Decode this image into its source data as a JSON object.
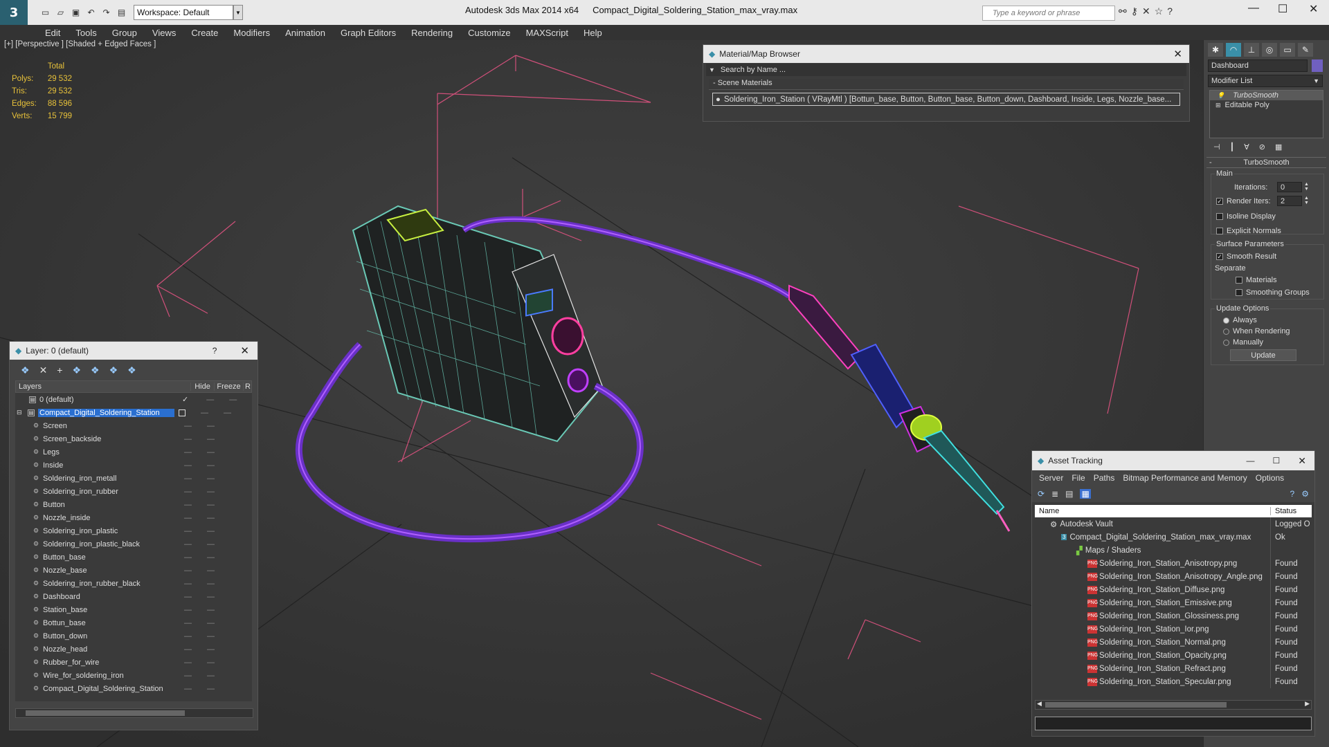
{
  "app": {
    "workspace": "Workspace: Default",
    "title_app": "Autodesk 3ds Max  2014 x64",
    "title_file": "Compact_Digital_Soldering_Station_max_vray.max",
    "search_placeholder": "Type a keyword or phrase"
  },
  "menu": [
    "Edit",
    "Tools",
    "Group",
    "Views",
    "Create",
    "Modifiers",
    "Animation",
    "Graph Editors",
    "Rendering",
    "Customize",
    "MAXScript",
    "Help"
  ],
  "viewport": {
    "label": "[+] [Perspective ] [Shaded + Edged Faces ]",
    "stats_header": "Total",
    "stats": [
      {
        "label": "Polys:",
        "value": "29 532"
      },
      {
        "label": "Tris:",
        "value": "29 532"
      },
      {
        "label": "Edges:",
        "value": "88 596"
      },
      {
        "label": "Verts:",
        "value": "15 799"
      }
    ]
  },
  "material_browser": {
    "title": "Material/Map Browser",
    "search": "Search by Name ...",
    "section": "- Scene Materials",
    "item": "Soldering_Iron_Station ( VRayMtl ) [Bottun_base, Button, Button_base, Button_down, Dashboard, Inside, Legs, Nozzle_base..."
  },
  "layer_panel": {
    "title": "Layer: 0 (default)",
    "help": "?",
    "col_layers": "Layers",
    "col_hide": "Hide",
    "col_freeze": "Freeze",
    "col_r": "R",
    "default_layer": "0 (default)",
    "station_layer": "Compact_Digital_Soldering_Station",
    "objects": [
      "Screen",
      "Screen_backside",
      "Legs",
      "Inside",
      "Soldering_iron_metall",
      "Soldering_iron_rubber",
      "Button",
      "Nozzle_inside",
      "Soldering_iron_plastic",
      "Soldering_iron_plastic_black",
      "Button_base",
      "Nozzle_base",
      "Soldering_iron_rubber_black",
      "Dashboard",
      "Station_base",
      "Bottun_base",
      "Button_down",
      "Nozzle_head",
      "Rubber_for_wire",
      "Wire_for_soldering_iron",
      "Compact_Digital_Soldering_Station"
    ]
  },
  "command_panel": {
    "object_name": "Dashboard",
    "modifier_list": "Modifier List",
    "stack": [
      "TurboSmooth",
      "Editable Poly"
    ],
    "rollout": "TurboSmooth",
    "main": "Main",
    "iterations_label": "Iterations:",
    "iterations": "0",
    "render_iters_label": "Render Iters:",
    "render_iters": "2",
    "isoline": "Isoline Display",
    "explicit": "Explicit Normals",
    "surface": "Surface Parameters",
    "smooth_result": "Smooth Result",
    "separate": "Separate",
    "materials": "Materials",
    "smoothing_groups": "Smoothing Groups",
    "update_options": "Update Options",
    "always": "Always",
    "when_rendering": "When Rendering",
    "manually": "Manually",
    "update_btn": "Update"
  },
  "asset_tracking": {
    "title": "Asset Tracking",
    "menu": [
      "Server",
      "File",
      "Paths",
      "Bitmap Performance and Memory",
      "Options"
    ],
    "col_name": "Name",
    "col_status": "Status",
    "vault": "Autodesk Vault",
    "vault_status": "Logged O",
    "file": "Compact_Digital_Soldering_Station_max_vray.max",
    "file_status": "Ok",
    "maps": "Maps / Shaders",
    "files": [
      {
        "name": "Soldering_Iron_Station_Anisotropy.png",
        "status": "Found"
      },
      {
        "name": "Soldering_Iron_Station_Anisotropy_Angle.png",
        "status": "Found"
      },
      {
        "name": "Soldering_Iron_Station_Diffuse.png",
        "status": "Found"
      },
      {
        "name": "Soldering_Iron_Station_Emissive.png",
        "status": "Found"
      },
      {
        "name": "Soldering_Iron_Station_Glossiness.png",
        "status": "Found"
      },
      {
        "name": "Soldering_Iron_Station_Ior.png",
        "status": "Found"
      },
      {
        "name": "Soldering_Iron_Station_Normal.png",
        "status": "Found"
      },
      {
        "name": "Soldering_Iron_Station_Opacity.png",
        "status": "Found"
      },
      {
        "name": "Soldering_Iron_Station_Refract.png",
        "status": "Found"
      },
      {
        "name": "Soldering_Iron_Station_Specular.png",
        "status": "Found"
      }
    ]
  }
}
